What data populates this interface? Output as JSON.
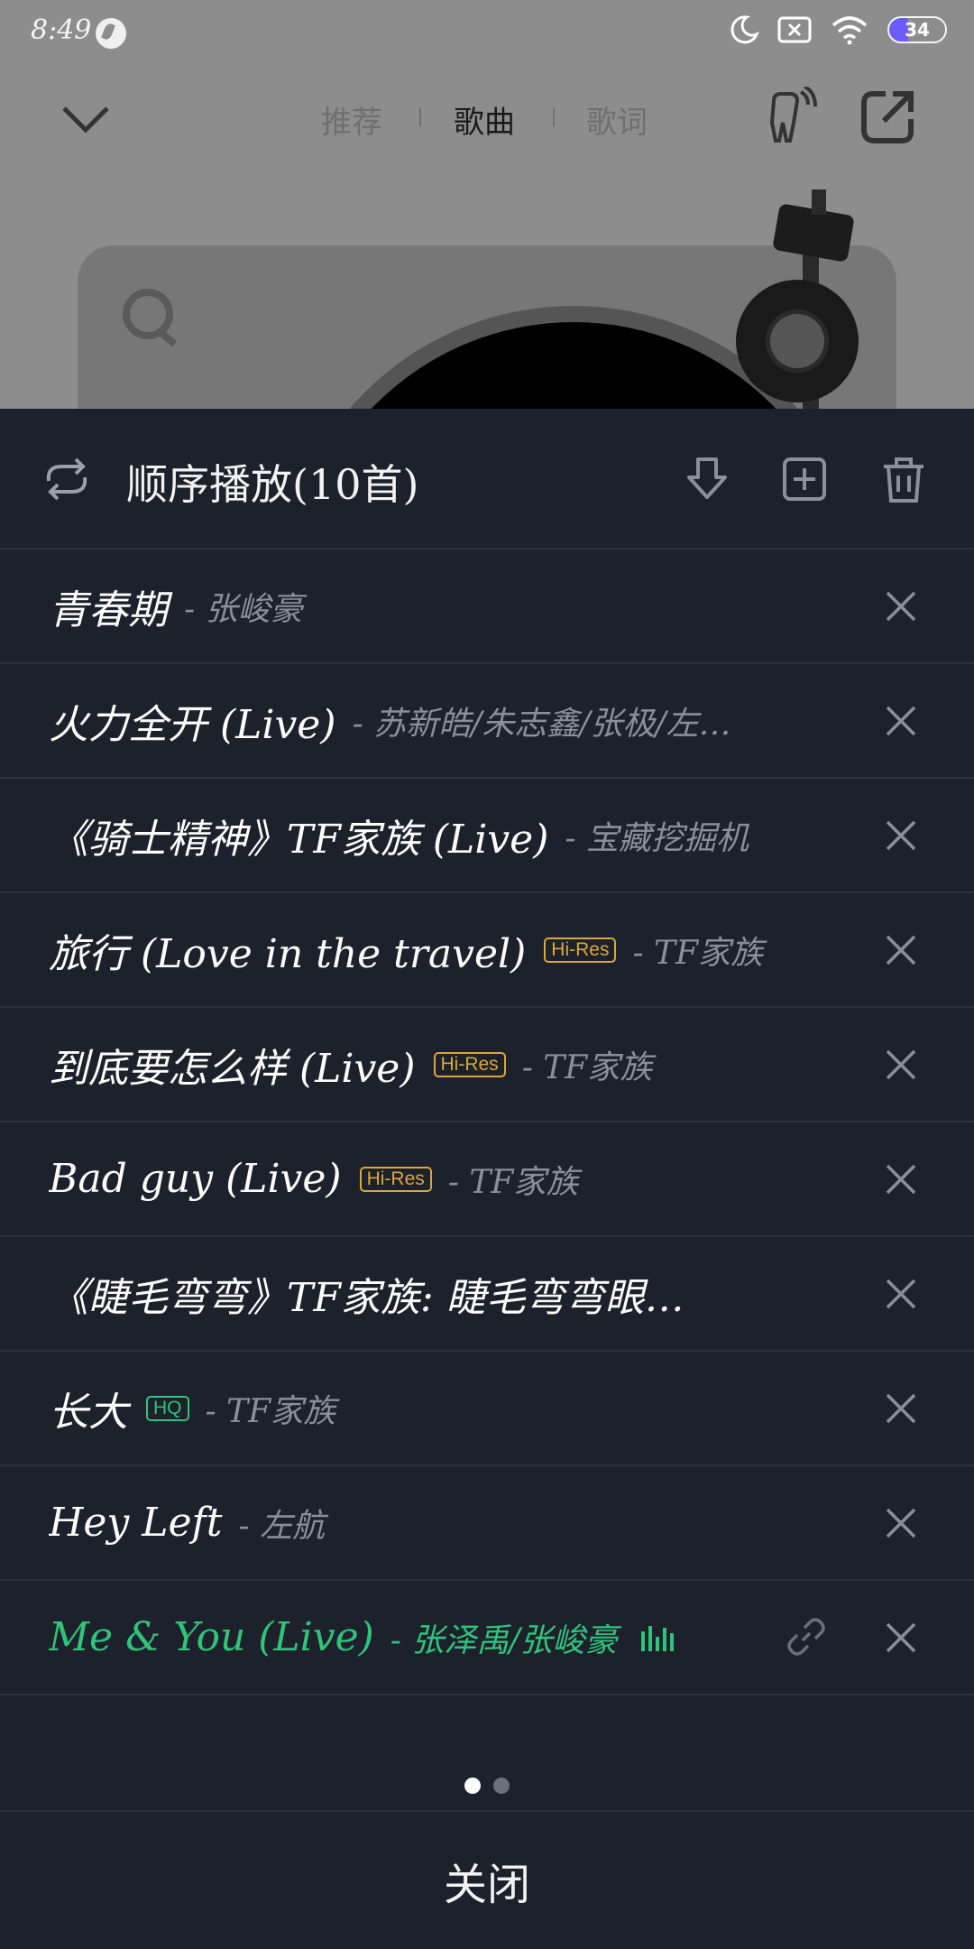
{
  "status_bar": {
    "time": "8:49",
    "battery": "34"
  },
  "nav": {
    "tabs": [
      "推荐",
      "歌曲",
      "歌词"
    ],
    "active_tab": 1
  },
  "playlist": {
    "title": "顺序播放(10首)",
    "songs": [
      {
        "title": "青春期",
        "artist": "- 张峻豪",
        "badge": "",
        "playing": false
      },
      {
        "title": "火力全开 (Live)",
        "artist": "- 苏新皓/朱志鑫/张极/左…",
        "badge": "",
        "playing": false
      },
      {
        "title": "《骑士精神》TF家族 (Live)",
        "artist": "- 宝藏挖掘机",
        "badge": "",
        "playing": false
      },
      {
        "title": "旅行 (Love in the travel)",
        "artist": "- TF家族",
        "badge": "Hi-Res",
        "playing": false
      },
      {
        "title": "到底要怎么样 (Live)",
        "artist": "- TF家族",
        "badge": "Hi-Res",
        "playing": false
      },
      {
        "title": "Bad guy (Live)",
        "artist": "- TF家族",
        "badge": "Hi-Res",
        "playing": false
      },
      {
        "title": "《睫毛弯弯》TF家族: 睫毛弯弯眼…",
        "artist": "",
        "badge": "",
        "playing": false
      },
      {
        "title": "长大",
        "artist": "- TF家族",
        "badge": "HQ",
        "playing": false
      },
      {
        "title": "Hey Left",
        "artist": "- 左航",
        "badge": "",
        "playing": false
      },
      {
        "title": "Me & You (Live)",
        "artist": "- 张泽禹/张峻豪",
        "badge": "",
        "playing": true
      }
    ]
  },
  "pager": {
    "count": 2,
    "active": 0
  },
  "close_label": "关闭",
  "colors": {
    "accent": "#31c27c",
    "hires": "#d8a83c",
    "sheet_bg": "#1d212b"
  }
}
